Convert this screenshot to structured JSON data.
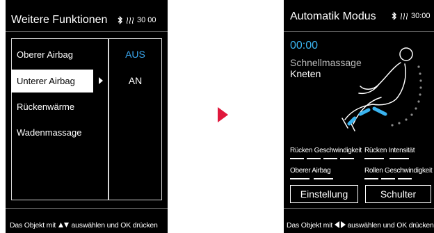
{
  "left_screen": {
    "title": "Weitere Funktionen",
    "status": "30 00",
    "menu_items": [
      {
        "label": "Oberer Airbag",
        "selected": false
      },
      {
        "label": "Unterer Airbag",
        "selected": true
      },
      {
        "label": "Rückenwärme",
        "selected": false
      },
      {
        "label": "Wadenmassage",
        "selected": false
      }
    ],
    "options": [
      {
        "label": "AUS",
        "highlighted": true
      },
      {
        "label": "AN",
        "highlighted": false
      }
    ],
    "footer": {
      "prefix": "Das Objekt mit",
      "suffix": "auswählen und OK drücken"
    }
  },
  "center_arrow": {
    "color": "#e0183c"
  },
  "right_screen": {
    "title": "Automatik Modus",
    "status": "30:00",
    "timer": "00:00",
    "program": "Schnellmassage",
    "technique": "Kneten",
    "labels": {
      "back_speed": "Rücken Geschwindigkeit",
      "back_intensity": "Rücken Intensität",
      "upper_airbag": "Oberer Airbag",
      "roller_speed": "Rollen Geschwindigkeit"
    },
    "buttons": {
      "setting": "Einstellung",
      "shoulder": "Schulter"
    },
    "footer": {
      "prefix": "Das Objekt mit",
      "suffix": "auswählen und OK drücken"
    }
  },
  "colors": {
    "accent_blue": "#3ab4f0",
    "option_blue": "#3aa8f0",
    "arrow_red": "#e0183c"
  }
}
